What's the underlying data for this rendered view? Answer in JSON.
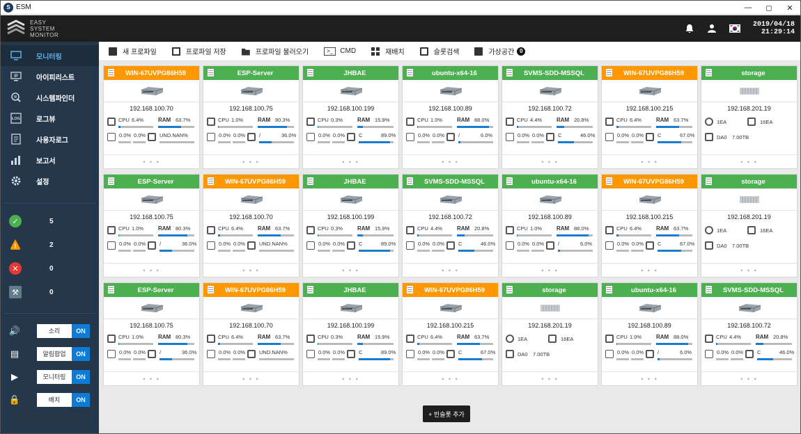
{
  "window": {
    "title": "ESM",
    "controls": [
      "—",
      "◻",
      "✕"
    ]
  },
  "header": {
    "logo_lines": [
      "EASY",
      "SYSTEM",
      "MONITOR"
    ],
    "date": "2019/04/18",
    "time": "21:29:14"
  },
  "sidebar": {
    "nav": [
      {
        "label": "모니터링",
        "icon": "monitor-icon",
        "active": true
      },
      {
        "label": "아이피리스트",
        "icon": "ip-list-icon"
      },
      {
        "label": "시스템파인더",
        "icon": "finder-icon"
      },
      {
        "label": "로그뷰",
        "icon": "log-icon"
      },
      {
        "label": "사용자로그",
        "icon": "user-log-icon"
      },
      {
        "label": "보고서",
        "icon": "report-icon"
      },
      {
        "label": "설정",
        "icon": "settings-icon"
      }
    ],
    "stats": [
      {
        "icon": "ok-icon",
        "count": "5",
        "color": "#4caf50"
      },
      {
        "icon": "warning-icon",
        "count": "2",
        "color": "#ff9800"
      },
      {
        "icon": "error-icon",
        "count": "0",
        "color": "#e53935"
      },
      {
        "icon": "tool-icon",
        "count": "0",
        "color": "#607d8b"
      }
    ],
    "toggles": [
      {
        "icon": "sound-icon",
        "label": "소리",
        "state": "ON"
      },
      {
        "icon": "popup-icon",
        "label": "알림팝업",
        "state": "ON"
      },
      {
        "icon": "play-icon",
        "label": "모니터링",
        "state": "ON"
      },
      {
        "icon": "lock-icon",
        "label": "배치",
        "state": "ON"
      }
    ]
  },
  "toolbar": {
    "new_profile": "새 프로파일",
    "save_profile": "프로파일 저장",
    "load_profile": "프로파일 불러오기",
    "cmd_icon": ">_",
    "cmd": "CMD",
    "rearrange": "재배치",
    "slot_search": "슬롯검색",
    "virtual_space": "가상공간",
    "virtual_count": "0"
  },
  "add_slot": "+ 빈슬롯 추가",
  "labels": {
    "cpu": "CPU",
    "ram": "RAM",
    "ea_unit": "EA"
  },
  "cards": [
    {
      "name": "WIN-67UVPG86H59",
      "status": "warn",
      "ip": "192.168.100.70",
      "kind": "server",
      "cpu": "6.4%",
      "ram": "63.7%",
      "cpu_v": 6.4,
      "ram_v": 63.7,
      "n1": "0.0%",
      "n2": "0.0%",
      "dl": "UND.NAN%",
      "dv": 0
    },
    {
      "name": "ESP-Server",
      "status": "ok",
      "ip": "192.168.100.75",
      "kind": "server",
      "cpu": "1.0%",
      "ram": "80.3%",
      "cpu_v": 1,
      "ram_v": 80.3,
      "n1": "0.0%",
      "n2": "0.0%",
      "dl": "/",
      "dp": "36.0%",
      "dv": 36
    },
    {
      "name": "JHBAE",
      "status": "ok",
      "ip": "192.168.100.199",
      "kind": "server",
      "cpu": "0.3%",
      "ram": "15.9%",
      "cpu_v": 0.3,
      "ram_v": 15.9,
      "n1": "0.0%",
      "n2": "0.0%",
      "dl": "C",
      "dp": "89.0%",
      "dv": 89
    },
    {
      "name": "ubuntu-x64-16",
      "status": "ok",
      "ip": "192.168.100.89",
      "kind": "server",
      "cpu": "1.0%",
      "ram": "88.0%",
      "cpu_v": 1,
      "ram_v": 88,
      "n1": "0.0%",
      "n2": "0.0%",
      "dl": "/",
      "dp": "6.0%",
      "dv": 6
    },
    {
      "name": "SVMS-SDD-MSSQL",
      "status": "ok",
      "ip": "192.168.100.72",
      "kind": "server",
      "cpu": "4.4%",
      "ram": "20.8%",
      "cpu_v": 4.4,
      "ram_v": 20.8,
      "n1": "0.0%",
      "n2": "0.0%",
      "dl": "C",
      "dp": "46.0%",
      "dv": 46
    },
    {
      "name": "WIN-67UVPG86H59",
      "status": "warn",
      "ip": "192.168.100.215",
      "kind": "server",
      "cpu": "6.4%",
      "ram": "63.7%",
      "cpu_v": 6.4,
      "ram_v": 63.7,
      "n1": "0.0%",
      "n2": "0.0%",
      "dl": "C",
      "dp": "67.0%",
      "dv": 67
    },
    {
      "name": "storage",
      "status": "ok",
      "ip": "192.168.201.19",
      "kind": "storage",
      "ea1": "1EA",
      "ea2": "16EA",
      "da": "DA0",
      "cap": "7.00TB"
    },
    {
      "name": "ESP-Server",
      "status": "ok",
      "ip": "192.168.100.75",
      "kind": "server",
      "cpu": "1.0%",
      "ram": "80.3%",
      "cpu_v": 1,
      "ram_v": 80.3,
      "n1": "0.0%",
      "n2": "0.0%",
      "dl": "/",
      "dp": "36.0%",
      "dv": 36
    },
    {
      "name": "WIN-67UVPG86H59",
      "status": "warn",
      "ip": "192.168.100.70",
      "kind": "server",
      "cpu": "6.4%",
      "ram": "63.7%",
      "cpu_v": 6.4,
      "ram_v": 63.7,
      "n1": "0.0%",
      "n2": "0.0%",
      "dl": "UND.NAN%",
      "dv": 0
    },
    {
      "name": "JHBAE",
      "status": "ok",
      "ip": "192.168.100.199",
      "kind": "server",
      "cpu": "0.3%",
      "ram": "15.9%",
      "cpu_v": 0.3,
      "ram_v": 15.9,
      "n1": "0.0%",
      "n2": "0.0%",
      "dl": "C",
      "dp": "89.0%",
      "dv": 89
    },
    {
      "name": "SVMS-SDD-MSSQL",
      "status": "ok",
      "ip": "192.168.100.72",
      "kind": "server",
      "cpu": "4.4%",
      "ram": "20.8%",
      "cpu_v": 4.4,
      "ram_v": 20.8,
      "n1": "0.0%",
      "n2": "0.0%",
      "dl": "C",
      "dp": "46.0%",
      "dv": 46
    },
    {
      "name": "ubuntu-x64-16",
      "status": "ok",
      "ip": "192.168.100.89",
      "kind": "server",
      "cpu": "1.0%",
      "ram": "88.0%",
      "cpu_v": 1,
      "ram_v": 88,
      "n1": "0.0%",
      "n2": "0.0%",
      "dl": "/",
      "dp": "6.0%",
      "dv": 6
    },
    {
      "name": "WIN-67UVPG86H59",
      "status": "warn",
      "ip": "192.168.100.215",
      "kind": "server",
      "cpu": "6.4%",
      "ram": "63.7%",
      "cpu_v": 6.4,
      "ram_v": 63.7,
      "n1": "0.0%",
      "n2": "0.0%",
      "dl": "C",
      "dp": "67.0%",
      "dv": 67
    },
    {
      "name": "storage",
      "status": "ok",
      "ip": "192.168.201.19",
      "kind": "storage",
      "ea1": "1EA",
      "ea2": "16EA",
      "da": "DA0",
      "cap": "7.00TB"
    },
    {
      "name": "ESP-Server",
      "status": "ok",
      "ip": "192.168.100.75",
      "kind": "server",
      "cpu": "1.0%",
      "ram": "80.3%",
      "cpu_v": 1,
      "ram_v": 80.3,
      "n1": "0.0%",
      "n2": "0.0%",
      "dl": "/",
      "dp": "36.0%",
      "dv": 36
    },
    {
      "name": "WIN-67UVPG86H59",
      "status": "warn",
      "ip": "192.168.100.70",
      "kind": "server",
      "cpu": "6.4%",
      "ram": "63.7%",
      "cpu_v": 6.4,
      "ram_v": 63.7,
      "n1": "0.0%",
      "n2": "0.0%",
      "dl": "UND.NAN%",
      "dv": 0
    },
    {
      "name": "JHBAE",
      "status": "ok",
      "ip": "192.168.100.199",
      "kind": "server",
      "cpu": "0.3%",
      "ram": "15.9%",
      "cpu_v": 0.3,
      "ram_v": 15.9,
      "n1": "0.0%",
      "n2": "0.0%",
      "dl": "C",
      "dp": "89.0%",
      "dv": 89
    },
    {
      "name": "WIN-67UVPG86H59",
      "status": "warn",
      "ip": "192.168.100.215",
      "kind": "server",
      "cpu": "6.4%",
      "ram": "63.7%",
      "cpu_v": 6.4,
      "ram_v": 63.7,
      "n1": "0.0%",
      "n2": "0.0%",
      "dl": "C",
      "dp": "67.0%",
      "dv": 67
    },
    {
      "name": "storage",
      "status": "ok",
      "ip": "192.168.201.19",
      "kind": "storage",
      "ea1": "1EA",
      "ea2": "16EA",
      "da": "DA0",
      "cap": "7.00TB"
    },
    {
      "name": "ubuntu-x64-16",
      "status": "ok",
      "ip": "192.168.100.89",
      "kind": "server",
      "cpu": "1.0%",
      "ram": "88.0%",
      "cpu_v": 1,
      "ram_v": 88,
      "n1": "0.0%",
      "n2": "0.0%",
      "dl": "/",
      "dp": "6.0%",
      "dv": 6
    },
    {
      "name": "SVMS-SDD-MSSQL",
      "status": "ok",
      "ip": "192.168.100.72",
      "kind": "server",
      "cpu": "4.4%",
      "ram": "20.8%",
      "cpu_v": 4.4,
      "ram_v": 20.8,
      "n1": "0.0%",
      "n2": "0.0%",
      "dl": "C",
      "dp": "46.0%",
      "dv": 46
    }
  ]
}
